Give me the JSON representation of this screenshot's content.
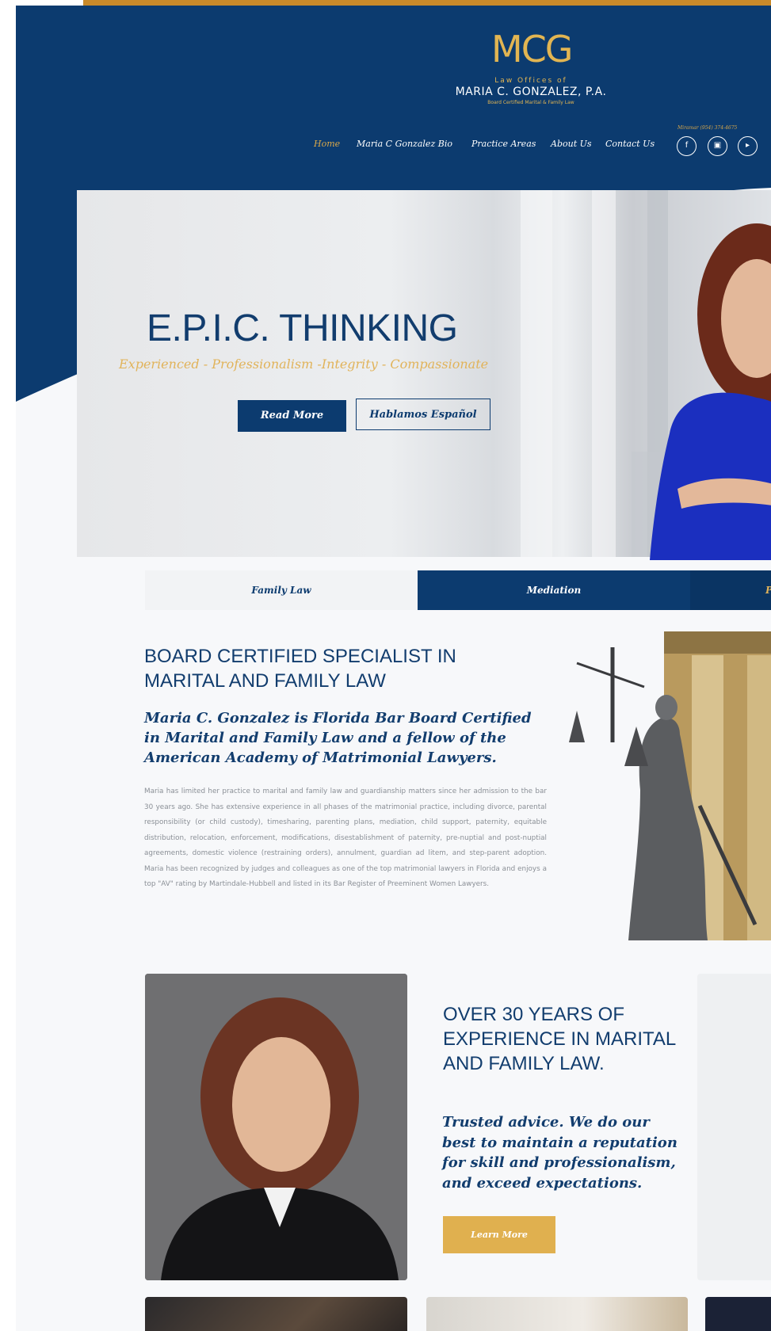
{
  "logo": {
    "mark": "MCG",
    "subtitle": "Law Offices of",
    "name": "MARIA C. GONZALEZ, P.A.",
    "tagline": "Board Certified Marital & Family Law"
  },
  "nav": {
    "items": [
      {
        "label": "Home"
      },
      {
        "label": "Maria C Gonzalez Bio"
      },
      {
        "label": "Practice Areas"
      },
      {
        "label": "About Us"
      },
      {
        "label": "Contact Us"
      }
    ],
    "phone": "Miramar (954) 374-4675"
  },
  "hero": {
    "title": "E.P.I.C. THINKING",
    "tagline": "Experienced - Professionalism -Integrity - Compassionate",
    "read_more": "Read More",
    "spanish": "Hablamos Español"
  },
  "tabs": [
    {
      "label": "Family Law"
    },
    {
      "label": "Mediation"
    },
    {
      "label": "Pro"
    }
  ],
  "section1": {
    "heading": "BOARD CERTIFIED SPECIALIST IN MARITAL AND FAMILY LAW",
    "subheading": "Maria C. Gonzalez is Florida Bar Board Certified in Marital and Family Law and a fellow of the American Academy of Matrimonial Lawyers.",
    "body": "Maria has limited her practice to marital and family law and guardianship matters since her admission to the bar 30 years ago. She has extensive experience in all phases of the matrimonial practice, including divorce, parental responsibility (or child custody), timesharing, parenting plans, mediation, child support, paternity, equitable distribution, relocation, enforcement, modifications, disestablishment of paternity, pre-nuptial and post-nuptial agreements, domestic violence (restraining orders), annulment, guardian ad litem, and step-parent adoption. Maria has been recognized by judges and colleagues as one of the top matrimonial lawyers in Florida and enjoys a top \"AV\" rating by Martindale-Hubbell and listed in its Bar Register of Preeminent Women Lawyers."
  },
  "section2": {
    "heading": "OVER 30 YEARS OF EXPERIENCE IN MARITAL AND FAMILY LAW.",
    "subheading": "Trusted advice. We do our best to maintain a reputation for skill and professionalism, and exceed expectations.",
    "button": "Learn More"
  },
  "colors": {
    "navy": "#0c3b6f",
    "gold": "#e0b04f",
    "accent_bar": "#c98a2a"
  },
  "icons": [
    "facebook-icon",
    "instagram-icon",
    "youtube-icon"
  ]
}
